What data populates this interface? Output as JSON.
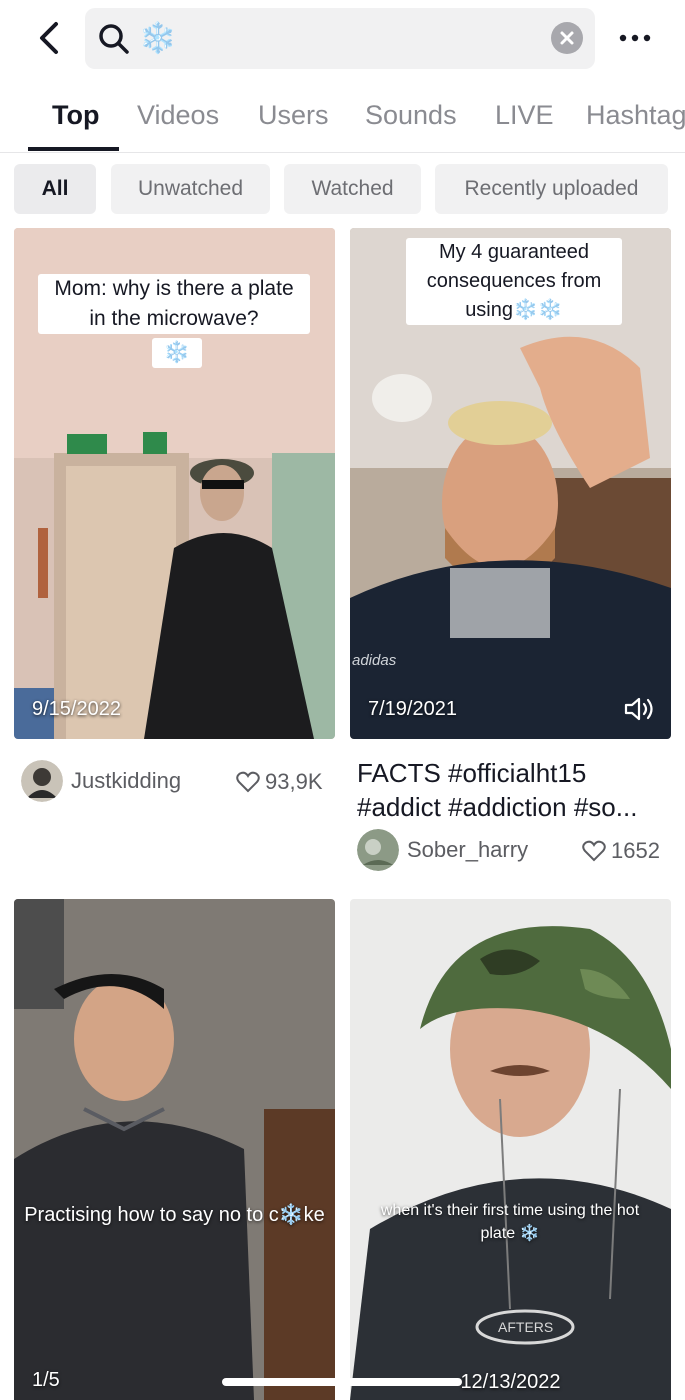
{
  "search": {
    "query": "❄️"
  },
  "tabs": [
    {
      "label": "Top",
      "active": true
    },
    {
      "label": "Videos",
      "active": false
    },
    {
      "label": "Users",
      "active": false
    },
    {
      "label": "Sounds",
      "active": false
    },
    {
      "label": "LIVE",
      "active": false
    },
    {
      "label": "Hashtags",
      "active": false
    }
  ],
  "filters": [
    {
      "label": "All",
      "active": true
    },
    {
      "label": "Unwatched",
      "active": false
    },
    {
      "label": "Watched",
      "active": false
    },
    {
      "label": "Recently uploaded",
      "active": false
    }
  ],
  "videos": [
    {
      "caption": "Mom: why is there a plate in the microwave?",
      "caption_emoji": "❄️",
      "date": "9/15/2022",
      "author": "Justkidding",
      "likes": "93,9K"
    },
    {
      "caption": "My 4 guaranteed consequences from using",
      "caption_emoji": "❄️❄️",
      "date": "7/19/2021",
      "watermark": "adidas",
      "description": "FACTS #officialht15 #addict #addiction #so...",
      "author": "Sober_harry",
      "likes": "1652"
    },
    {
      "caption": "Practising how to say no to c❄️ke",
      "counter": "1/5"
    },
    {
      "caption": "when it's their first time using the hot plate ❄️",
      "date": "12/13/2022",
      "shirt_text": "AFTERS"
    }
  ],
  "colors": {
    "accent": "#161823",
    "muted": "#8a8b91",
    "search_bg": "#f1f1f2",
    "snow": "#2b9ee8"
  }
}
